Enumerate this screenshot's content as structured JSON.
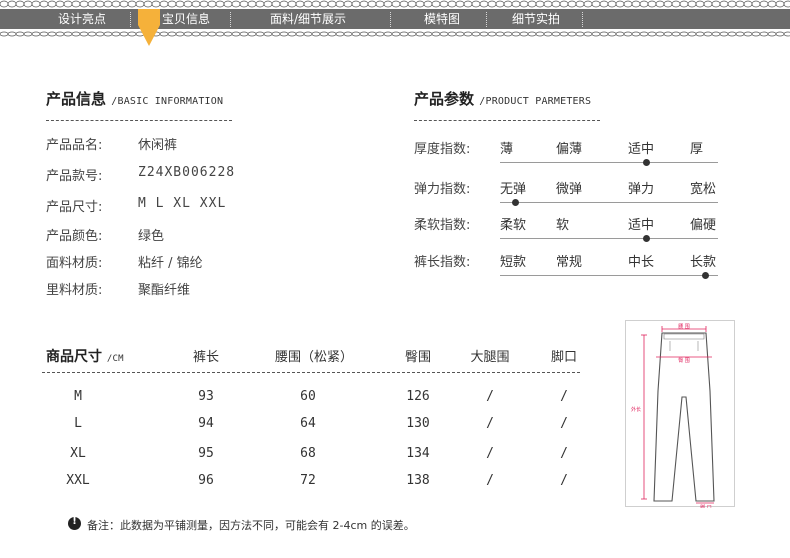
{
  "nav": {
    "items": [
      "设计亮点",
      "宝贝信息",
      "面料/细节展示",
      "模特图",
      "细节实拍"
    ],
    "bar_color": "#6b6b6b",
    "marker_color": "#f5b13a"
  },
  "product_info": {
    "title": "产品信息",
    "subtitle": "/BASIC INFORMATION",
    "rows": [
      {
        "label": "产品品名:",
        "value": "休闲裤"
      },
      {
        "label": "产品款号:",
        "value": "Z24XB006228"
      },
      {
        "label": "产品尺寸:",
        "value": "M L XL XXL"
      },
      {
        "label": "产品颜色:",
        "value": "绿色"
      },
      {
        "label": "面料材质:",
        "value": "粘纤 / 锦纶"
      },
      {
        "label": "里料材质:",
        "value": "聚酯纤维"
      }
    ]
  },
  "product_params": {
    "title": "产品参数",
    "subtitle": "/PRODUCT PARMETERS",
    "rows": [
      {
        "label": "厚度指数:",
        "options": [
          "薄",
          "偏薄",
          "适中",
          "厚"
        ],
        "selected": 2
      },
      {
        "label": "弹力指数:",
        "options": [
          "无弹",
          "微弹",
          "弹力",
          "宽松"
        ],
        "selected": 0
      },
      {
        "label": "柔软指数:",
        "options": [
          "柔软",
          "软",
          "适中",
          "偏硬"
        ],
        "selected": 2
      },
      {
        "label": "裤长指数:",
        "options": [
          "短款",
          "常规",
          "中长",
          "长款"
        ],
        "selected": 3
      }
    ]
  },
  "size_table": {
    "title": "商品尺寸",
    "unit": "/CM",
    "headers": [
      "裤长",
      "腰围（松紧）",
      "臀围",
      "大腿围",
      "脚口"
    ],
    "rows": [
      {
        "size": "M",
        "cells": [
          "93",
          "60",
          "126",
          "/",
          "/"
        ]
      },
      {
        "size": "L",
        "cells": [
          "94",
          "64",
          "130",
          "/",
          "/"
        ]
      },
      {
        "size": "XL",
        "cells": [
          "95",
          "68",
          "134",
          "/",
          "/"
        ]
      },
      {
        "size": "XXL",
        "cells": [
          "96",
          "72",
          "138",
          "/",
          "/"
        ]
      }
    ]
  },
  "diagram": {
    "labels": {
      "waist": "腰 围",
      "hip": "臀 围",
      "length": "外长",
      "hem": "脚 口"
    },
    "accent_color": "#e0245e"
  },
  "note": {
    "text": "备注：此数据为平铺测量，因方法不同，可能会有 2-4cm 的误差。"
  }
}
